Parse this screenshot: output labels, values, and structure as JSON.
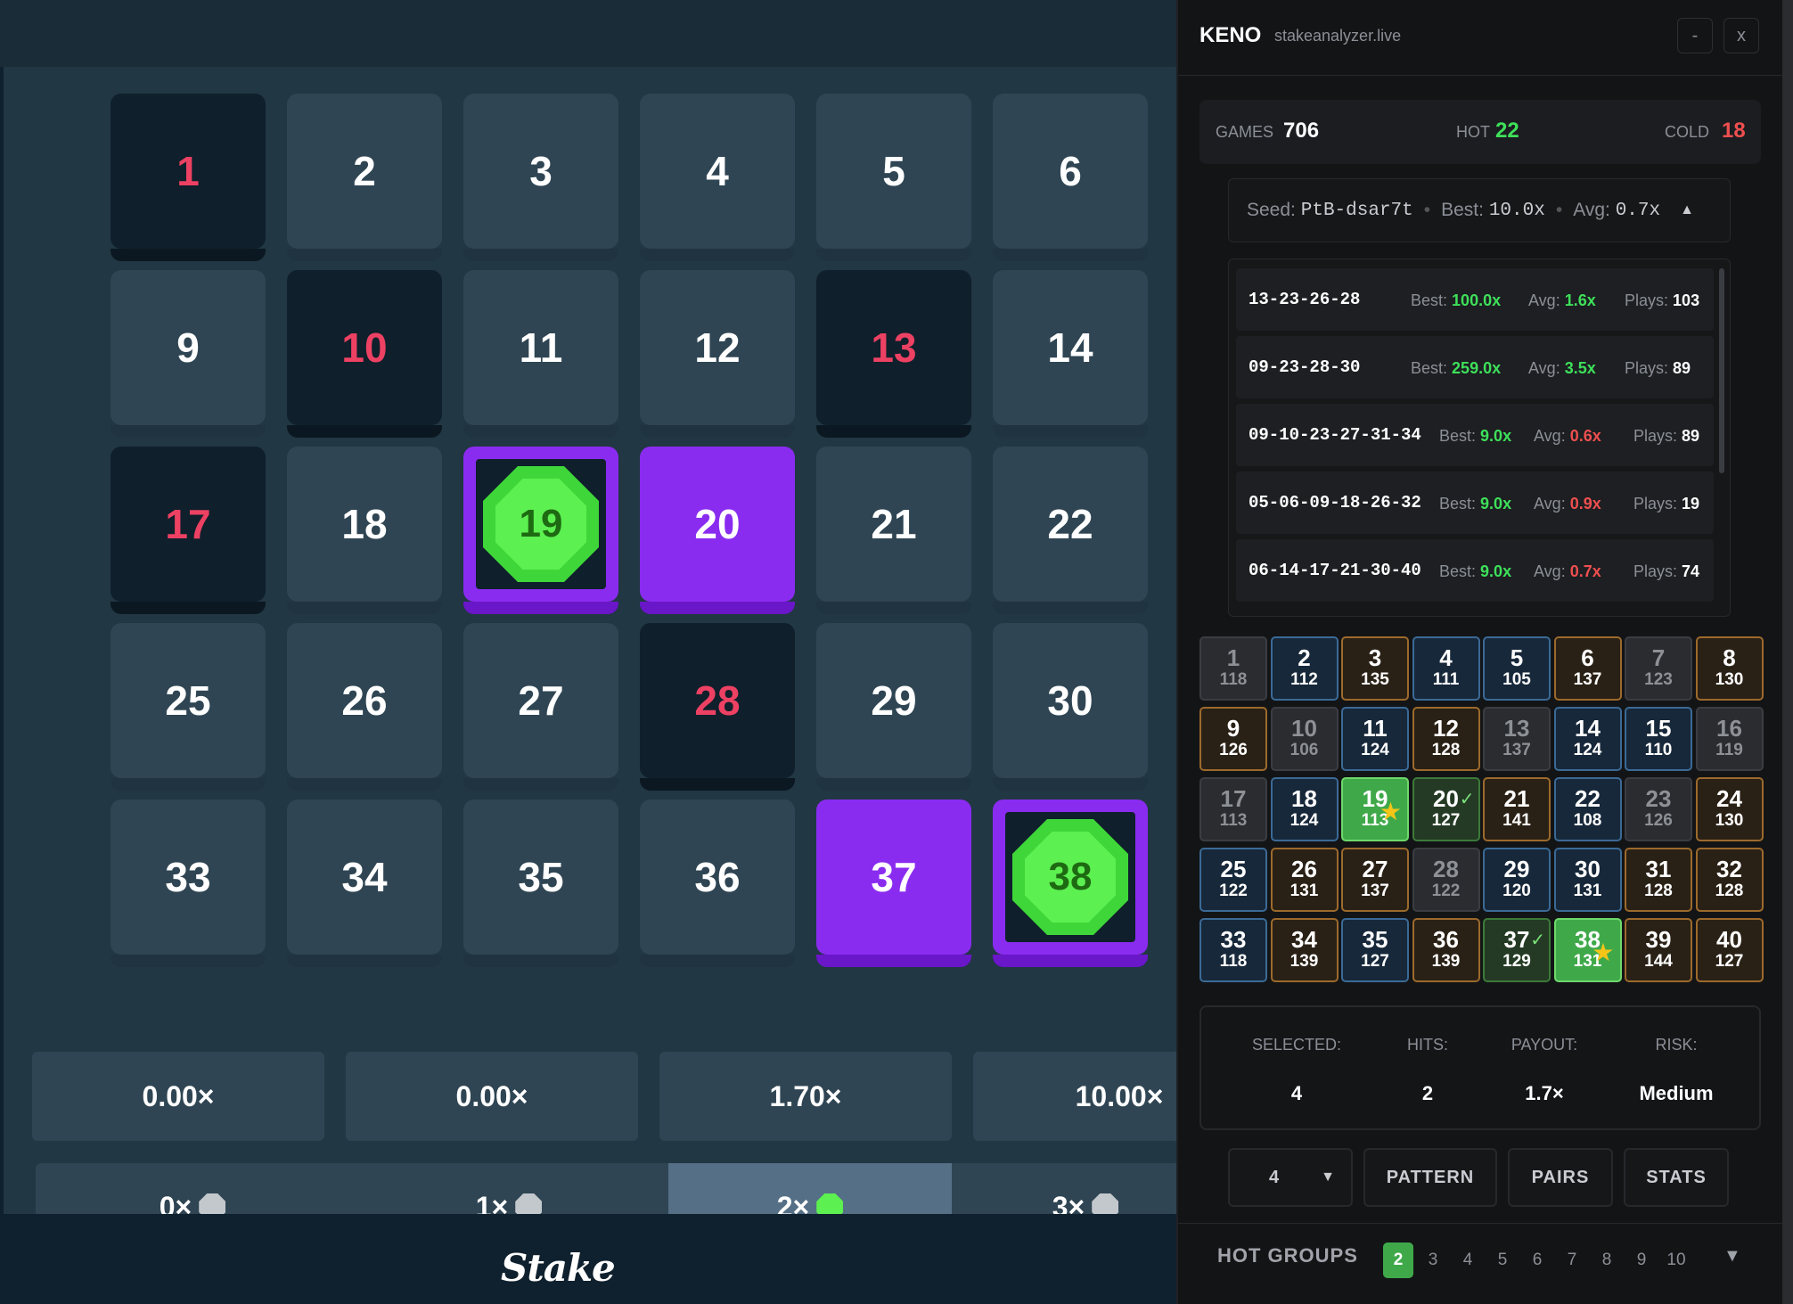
{
  "board": {
    "tiles": [
      {
        "n": "1",
        "state": "miss"
      },
      {
        "n": "2",
        "state": "normal"
      },
      {
        "n": "3",
        "state": "normal"
      },
      {
        "n": "4",
        "state": "normal"
      },
      {
        "n": "5",
        "state": "normal"
      },
      {
        "n": "6",
        "state": "normal"
      },
      {
        "n": "9",
        "state": "normal"
      },
      {
        "n": "10",
        "state": "miss"
      },
      {
        "n": "11",
        "state": "normal"
      },
      {
        "n": "12",
        "state": "normal"
      },
      {
        "n": "13",
        "state": "miss"
      },
      {
        "n": "14",
        "state": "normal"
      },
      {
        "n": "17",
        "state": "miss"
      },
      {
        "n": "18",
        "state": "normal"
      },
      {
        "n": "19",
        "state": "hit"
      },
      {
        "n": "20",
        "state": "selected"
      },
      {
        "n": "21",
        "state": "normal"
      },
      {
        "n": "22",
        "state": "normal"
      },
      {
        "n": "25",
        "state": "normal"
      },
      {
        "n": "26",
        "state": "normal"
      },
      {
        "n": "27",
        "state": "normal"
      },
      {
        "n": "28",
        "state": "miss"
      },
      {
        "n": "29",
        "state": "normal"
      },
      {
        "n": "30",
        "state": "normal"
      },
      {
        "n": "33",
        "state": "normal"
      },
      {
        "n": "34",
        "state": "normal"
      },
      {
        "n": "35",
        "state": "normal"
      },
      {
        "n": "36",
        "state": "normal"
      },
      {
        "n": "37",
        "state": "selected"
      },
      {
        "n": "38",
        "state": "hit"
      }
    ],
    "payouts": [
      "0.00×",
      "0.00×",
      "1.70×",
      "10.00×"
    ],
    "hit_labels": [
      {
        "label": "0×",
        "active": false
      },
      {
        "label": "1×",
        "active": false
      },
      {
        "label": "2×",
        "active": true
      },
      {
        "label": "3×",
        "active": false
      }
    ],
    "logo": "Stake"
  },
  "panel": {
    "title": "KENO",
    "site": "stakeanalyzer.live",
    "minimize_label": "-",
    "close_label": "x",
    "stats": {
      "games_label": "GAMES",
      "games_value": "706",
      "hot_label": "HOT",
      "hot_value": "22",
      "cold_label": "COLD",
      "cold_value": "18"
    },
    "seed": {
      "seed_label": "Seed:",
      "seed_value": "PtB-dsar7t",
      "best_label": "Best:",
      "best_value": "10.0x",
      "avg_label": "Avg:",
      "avg_value": "0.7x",
      "toggle_icon": "▲"
    },
    "patterns": [
      {
        "pattern": "13-23-26-28",
        "best": "100.0x",
        "avg": "1.6x",
        "avg_color": "green",
        "plays": "103"
      },
      {
        "pattern": "09-23-28-30",
        "best": "259.0x",
        "avg": "3.5x",
        "avg_color": "green",
        "plays": "89"
      },
      {
        "pattern": "09-10-23-27-31-34",
        "best": "9.0x",
        "avg": "0.6x",
        "avg_color": "red",
        "plays": "89"
      },
      {
        "pattern": "05-06-09-18-26-32",
        "best": "9.0x",
        "avg": "0.9x",
        "avg_color": "red",
        "plays": "19"
      },
      {
        "pattern": "06-14-17-21-30-40",
        "best": "9.0x",
        "avg": "0.7x",
        "avg_color": "red",
        "plays": "74"
      }
    ],
    "pattern_labels": {
      "best": "Best:",
      "avg": "Avg:",
      "plays": "Plays:"
    },
    "heatmap": [
      {
        "n": "1",
        "c": "118",
        "t": "gray"
      },
      {
        "n": "2",
        "c": "112",
        "t": "blue"
      },
      {
        "n": "3",
        "c": "135",
        "t": "orange"
      },
      {
        "n": "4",
        "c": "111",
        "t": "blue"
      },
      {
        "n": "5",
        "c": "105",
        "t": "blue"
      },
      {
        "n": "6",
        "c": "137",
        "t": "orange"
      },
      {
        "n": "7",
        "c": "123",
        "t": "gray"
      },
      {
        "n": "8",
        "c": "130",
        "t": "orange"
      },
      {
        "n": "9",
        "c": "126",
        "t": "orange"
      },
      {
        "n": "10",
        "c": "106",
        "t": "gray"
      },
      {
        "n": "11",
        "c": "124",
        "t": "blue"
      },
      {
        "n": "12",
        "c": "128",
        "t": "orange"
      },
      {
        "n": "13",
        "c": "137",
        "t": "gray"
      },
      {
        "n": "14",
        "c": "124",
        "t": "blue"
      },
      {
        "n": "15",
        "c": "110",
        "t": "blue"
      },
      {
        "n": "16",
        "c": "119",
        "t": "gray"
      },
      {
        "n": "17",
        "c": "113",
        "t": "gray"
      },
      {
        "n": "18",
        "c": "124",
        "t": "blue"
      },
      {
        "n": "19",
        "c": "113",
        "t": "ghit",
        "mark": "star"
      },
      {
        "n": "20",
        "c": "127",
        "t": "gsel",
        "mark": "check"
      },
      {
        "n": "21",
        "c": "141",
        "t": "orange"
      },
      {
        "n": "22",
        "c": "108",
        "t": "blue"
      },
      {
        "n": "23",
        "c": "126",
        "t": "gray"
      },
      {
        "n": "24",
        "c": "130",
        "t": "orange"
      },
      {
        "n": "25",
        "c": "122",
        "t": "blue"
      },
      {
        "n": "26",
        "c": "131",
        "t": "orange"
      },
      {
        "n": "27",
        "c": "137",
        "t": "orange"
      },
      {
        "n": "28",
        "c": "122",
        "t": "gray"
      },
      {
        "n": "29",
        "c": "120",
        "t": "blue"
      },
      {
        "n": "30",
        "c": "131",
        "t": "blue"
      },
      {
        "n": "31",
        "c": "128",
        "t": "orange"
      },
      {
        "n": "32",
        "c": "128",
        "t": "orange"
      },
      {
        "n": "33",
        "c": "118",
        "t": "blue"
      },
      {
        "n": "34",
        "c": "139",
        "t": "orange"
      },
      {
        "n": "35",
        "c": "127",
        "t": "blue"
      },
      {
        "n": "36",
        "c": "139",
        "t": "orange"
      },
      {
        "n": "37",
        "c": "129",
        "t": "gsel",
        "mark": "check"
      },
      {
        "n": "38",
        "c": "131",
        "t": "ghit",
        "mark": "star"
      },
      {
        "n": "39",
        "c": "144",
        "t": "orange"
      },
      {
        "n": "40",
        "c": "127",
        "t": "orange"
      }
    ],
    "info": {
      "selected_label": "SELECTED:",
      "selected_value": "4",
      "hits_label": "HITS:",
      "hits_value": "2",
      "payout_label": "PAYOUT:",
      "payout_value": "1.7×",
      "risk_label": "RISK:",
      "risk_value": "Medium"
    },
    "controls": {
      "count_value": "4",
      "dropdown_icon": "▼",
      "pattern_label": "PATTERN",
      "pairs_label": "PAIRS",
      "stats_label": "STATS"
    },
    "hot_groups": {
      "label": "HOT GROUPS",
      "options": [
        "2",
        "3",
        "4",
        "5",
        "6",
        "7",
        "8",
        "9",
        "10"
      ],
      "active": "2",
      "expand_icon": "▼"
    },
    "colors": {
      "accent_green": "#3ee05a",
      "accent_red": "#ef4f4f",
      "selected_purple": "#8a2cf0",
      "hit_gem": "#5cf050"
    }
  }
}
